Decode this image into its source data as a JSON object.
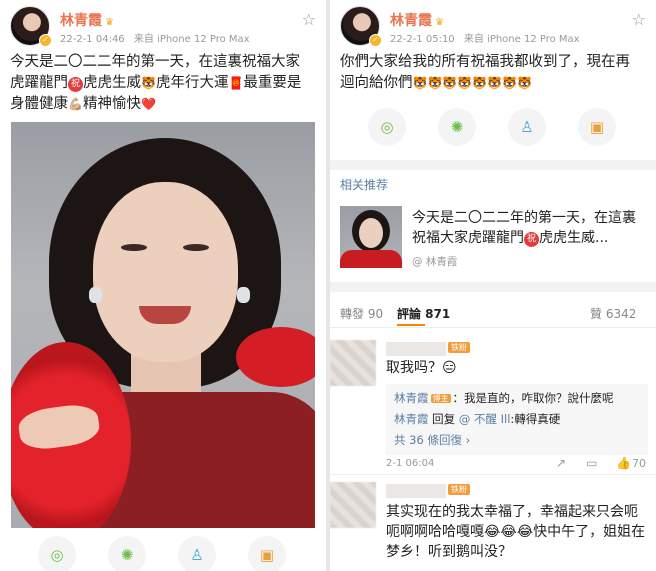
{
  "left": {
    "name": "林青霞",
    "time": "22-2-1 04:46",
    "source": "来自 iPhone 12 Pro Max",
    "text_parts": [
      "今天是二〇二二年的第一天，在這裏祝福大家虎躍龍門",
      "祝",
      "虎虎生威",
      "🐯",
      "虎年行大運",
      "🧧",
      "最重要是身體健康",
      "💪🏼",
      "精神愉快",
      "❤️"
    ]
  },
  "right": {
    "name": "林青霞",
    "time": "22-2-1 05:10",
    "source": "来自 iPhone 12 Pro Max",
    "text": "你們大家给我的所有祝福我都收到了，現在再迴向給你們",
    "tigers": "🐯🐯🐯🐯🐯🐯🐯🐯",
    "related_title": "相关推荐",
    "related_text_a": "今天是二〇二二年的第一天，在這裏祝福大家虎躍龍門",
    "related_zhu": "祝",
    "related_text_b": "虎虎生威...",
    "related_by": "@ 林青霞",
    "tabs": {
      "reposts": "轉發 90",
      "comments": "評論 871",
      "likes": "贊 6342"
    },
    "comment1": {
      "badge": "铁粉",
      "text": "取我吗？😑",
      "reply1_name": "林青霞",
      "reply1_tag": "博主",
      "reply1_text": "：我是直的，咋取你？說什麼呢",
      "reply2_name": "林青霞",
      "reply2_text": " 回复 ",
      "reply2_mention": "@ 不醒 Ill",
      "reply2_rest": ":轉得真硬",
      "more": "共 36 條回復 ›",
      "time": "2-1 06:04",
      "likes": "70"
    },
    "comment2": {
      "badge": "铁粉",
      "text": "其实现在的我太幸福了，幸福起来只会呃呃啊啊哈哈嘎嘎😂😂😂快中午了，姐姐在梦乡！听到鹅叫没？"
    }
  },
  "icons": {
    "share_wechat": "wechat-icon",
    "share_moments": "moments-icon",
    "share_qq": "qq-icon",
    "share_save": "save-icon"
  }
}
